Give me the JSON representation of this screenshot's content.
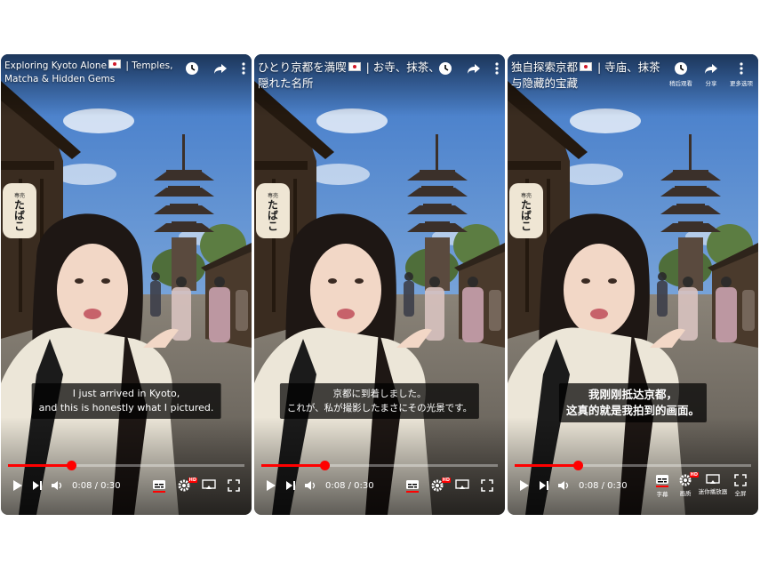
{
  "panels": [
    {
      "lang": "en",
      "title_before": "Exploring Kyoto Alone",
      "title_after": " | Temples, Matcha & Hidden Gems",
      "caption_line1": "I just arrived in Kyoto,",
      "caption_line2": "and this is honestly what I pictured.",
      "time": "0:08 / 0:30",
      "progress": 0.267,
      "labels": {
        "watch_later": "",
        "share": "",
        "more": "",
        "captions": "",
        "settings": "",
        "miniplayer": "",
        "fullscreen": ""
      }
    },
    {
      "lang": "ja",
      "title_before": "ひとり京都を満喫",
      "title_after": " | お寺、抹茶、隠れた名所",
      "caption_line1": "京都に到着しました。",
      "caption_line2": "これが、私が撮影したまさにその光景です。",
      "time": "0:08 / 0:30",
      "progress": 0.267,
      "labels": {
        "watch_later": "",
        "share": "",
        "more": "",
        "captions": "",
        "settings": "",
        "miniplayer": "",
        "fullscreen": ""
      }
    },
    {
      "lang": "zh",
      "title_before": "独自探索京都",
      "title_after": " | 寺庙、抹茶与隐藏的宝藏",
      "caption_line1": "我刚刚抵达京都，",
      "caption_line2": "这真的就是我拍到的画面。",
      "time": "0:08 / 0:30",
      "progress": 0.267,
      "labels": {
        "watch_later": "稍后观看",
        "share": "分享",
        "more": "更多选项",
        "captions": "字幕",
        "settings": "画质",
        "miniplayer": "迷你播放器",
        "fullscreen": "全屏"
      }
    }
  ],
  "shared": {
    "hd_badge": "HD",
    "sign_text": "たばこ",
    "sign_small": "専売",
    "accent_color": "#ff0000"
  }
}
